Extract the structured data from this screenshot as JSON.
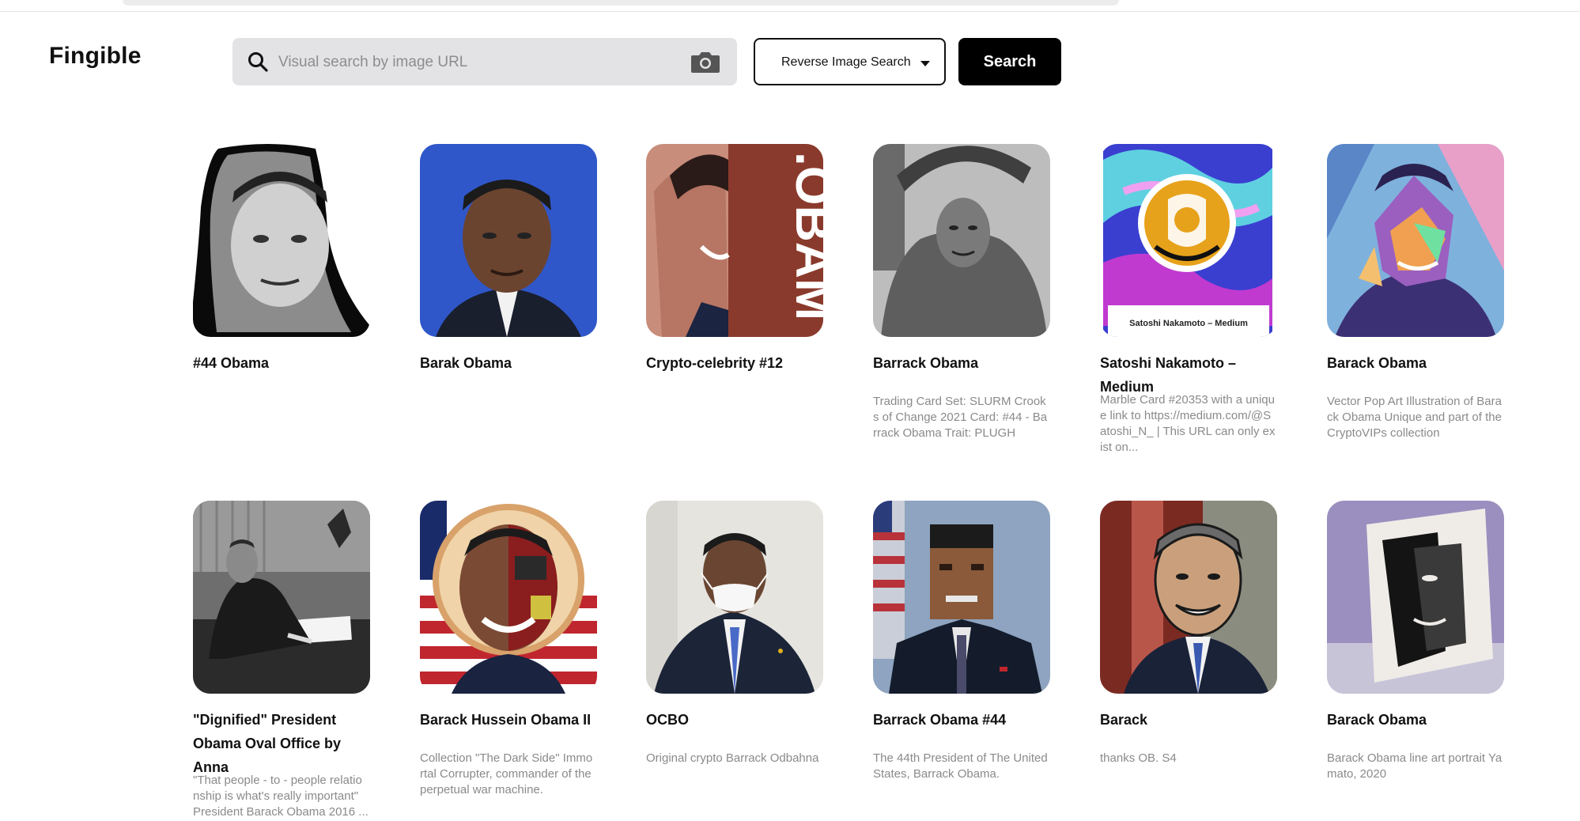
{
  "app": {
    "logo": "Fingible"
  },
  "search": {
    "placeholder": "Visual search by image URL",
    "mode_label": "Reverse Image Search",
    "button_label": "Search"
  },
  "cards": [
    {
      "title": "#44 Obama",
      "desc": ""
    },
    {
      "title": "Barak Obama",
      "desc": ""
    },
    {
      "title": "Crypto-celebrity #12",
      "desc": "",
      "overlay_text": ".OBAM"
    },
    {
      "title": "Barrack Obama",
      "desc": "Trading Card Set: SLURM Crooks of Change 2021 Card: #44 - Barrack Obama Trait: PLUGH"
    },
    {
      "title": "Satoshi Nakamoto – Medium",
      "desc": "Marble Card #20353 with a unique link to https://medium.com/@Satoshi_N_ | This URL can only exist on...",
      "overlay_text": "Satoshi Nakamoto – Medium"
    },
    {
      "title": "Barack Obama",
      "desc": "Vector Pop Art Illustration of Barack Obama Unique and part of the CryptoVIPs collection"
    },
    {
      "title": "\"Dignified\" President Obama Oval Office by Anna",
      "desc": "\"That people - to - people relationship is what's really important\" President Barack Obama 2016 ..."
    },
    {
      "title": "Barack Hussein Obama II",
      "desc": "Collection \"The Dark Side\" Immortal Corrupter, commander of the perpetual war machine."
    },
    {
      "title": "OCBO",
      "desc": "Original crypto Barrack Odbahna"
    },
    {
      "title": "Barrack Obama #44",
      "desc": "The 44th President of The United States, Barrack Obama."
    },
    {
      "title": "Barack",
      "desc": "thanks OB. S4"
    },
    {
      "title": "Barack Obama",
      "desc": "Barack Obama line art portrait Yamato, 2020"
    }
  ],
  "colors": {
    "accent": "#000000",
    "search_bg": "#e3e3e5",
    "desc_text": "#8a8a8a"
  }
}
